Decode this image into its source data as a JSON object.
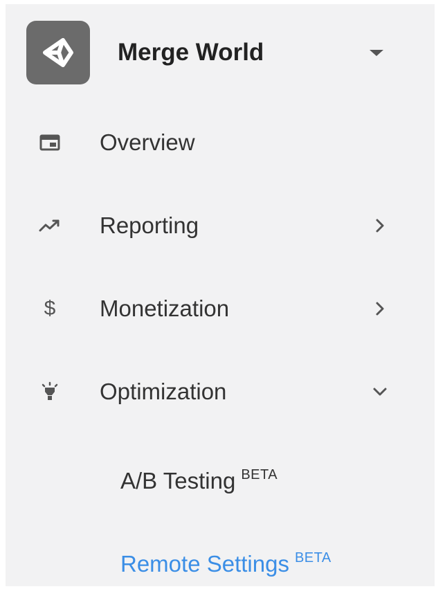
{
  "project": {
    "name": "Merge World",
    "logo_icon": "unity-logo-icon",
    "dropdown_icon": "caret-down-icon"
  },
  "nav": {
    "items": [
      {
        "id": "overview",
        "label": "Overview",
        "icon": "dashboard-icon",
        "expand": "none"
      },
      {
        "id": "reporting",
        "label": "Reporting",
        "icon": "trending-up-icon",
        "expand": "collapsed"
      },
      {
        "id": "monetization",
        "label": "Monetization",
        "icon": "dollar-icon",
        "icon_glyph": "$",
        "expand": "collapsed"
      },
      {
        "id": "optimization",
        "label": "Optimization",
        "icon": "lightbulb-icon",
        "expand": "expanded"
      }
    ],
    "optimization_children": [
      {
        "id": "ab-testing",
        "label": "A/B Testing",
        "badge": "BETA",
        "active": false
      },
      {
        "id": "remote-settings",
        "label": "Remote Settings",
        "badge": "BETA",
        "active": true
      }
    ]
  },
  "colors": {
    "background": "#f2f2f3",
    "text": "#333333",
    "icon": "#555555",
    "logo_bg": "#6b6b6b",
    "active_link": "#3b8ee6"
  }
}
